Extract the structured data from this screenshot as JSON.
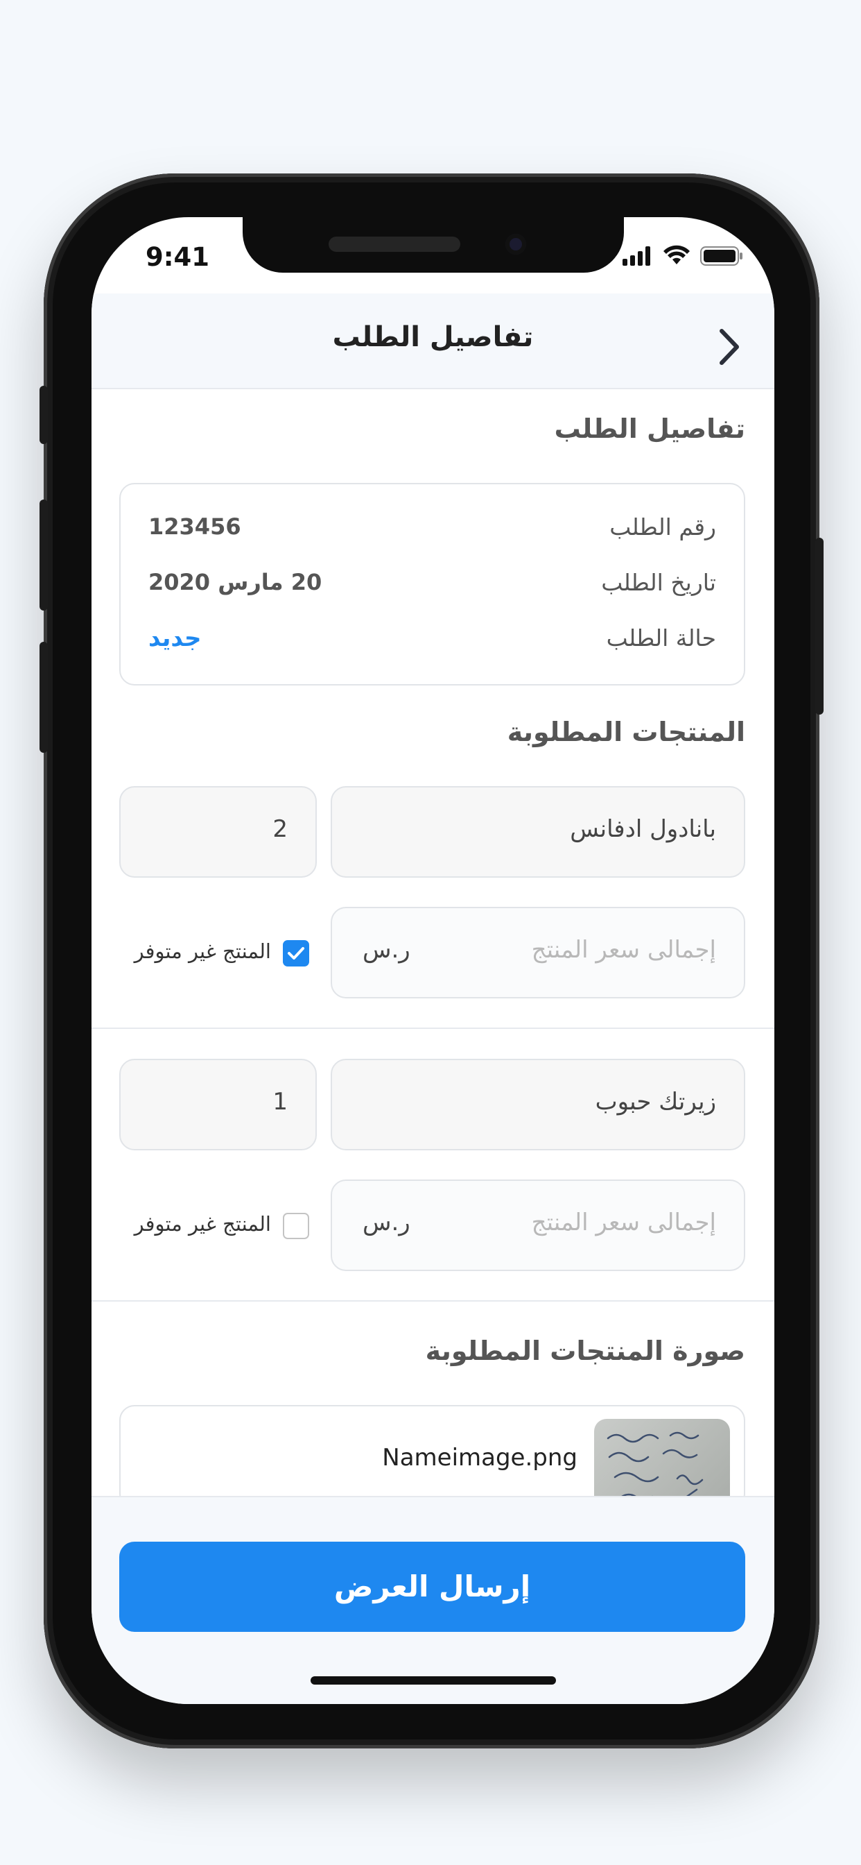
{
  "status_bar": {
    "time": "9:41"
  },
  "header": {
    "title": "تفاصيل الطلب"
  },
  "order_section": {
    "title": "تفاصيل الطلب",
    "rows": [
      {
        "label": "رقم الطلب",
        "value": "123456"
      },
      {
        "label": "تاريخ الطلب",
        "value": "20 مارس 2020"
      },
      {
        "label": "حالة الطلب",
        "value": "جديد"
      }
    ]
  },
  "products_section": {
    "title": "المنتجات المطلوبة",
    "items": [
      {
        "name": "بانادول ادفانس",
        "quantity": "2",
        "price_placeholder": "إجمالى سعر المنتج",
        "currency": "ر.س",
        "unavailable_label": "المنتج غير متوفر",
        "unavailable_checked": true
      },
      {
        "name": "زيرتك حبوب",
        "quantity": "1",
        "price_placeholder": "إجمالى سعر المنتج",
        "currency": "ر.س",
        "unavailable_label": "المنتج غير متوفر",
        "unavailable_checked": false
      }
    ]
  },
  "image_section": {
    "title": "صورة المنتجات المطلوبة",
    "file_name": "Nameimage.png"
  },
  "footer": {
    "submit_label": "إرسال العرض"
  },
  "colors": {
    "accent": "#1e88f0",
    "header_bg": "#f5f8fc"
  }
}
